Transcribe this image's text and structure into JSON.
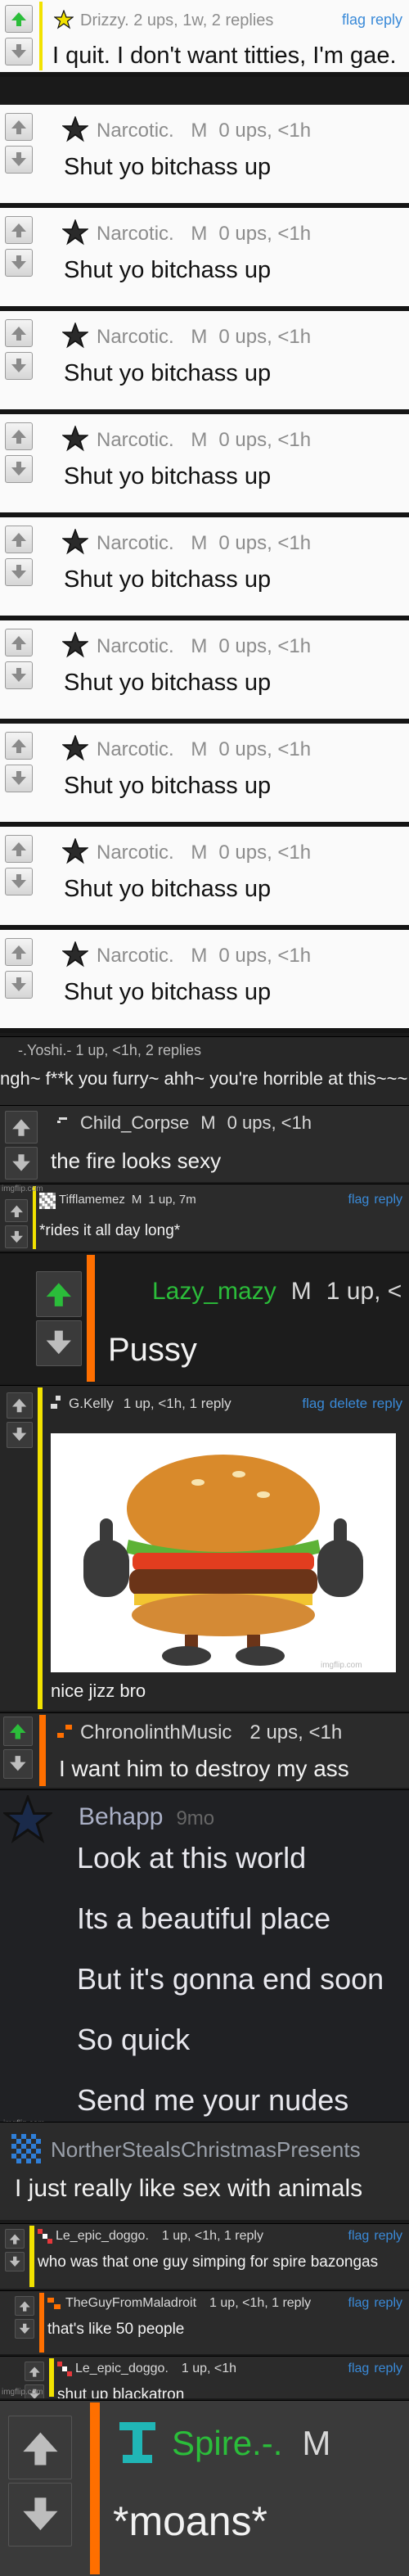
{
  "comments": [
    {
      "user": "Drizzy.",
      "stats": "2 ups, 1w, 2 replies",
      "links": [
        "flag",
        "reply"
      ],
      "text": "I quit. I don't want titties, I'm gae.",
      "upvoted": true
    },
    {
      "user": "Narcotic.",
      "badge": "M",
      "stats": "0 ups, <1h",
      "text": "Shut yo bitchass up"
    },
    {
      "user": "Narcotic.",
      "badge": "M",
      "stats": "0 ups, <1h",
      "text": "Shut yo bitchass up"
    },
    {
      "user": "Narcotic.",
      "badge": "M",
      "stats": "0 ups, <1h",
      "text": "Shut yo bitchass up"
    },
    {
      "user": "Narcotic.",
      "badge": "M",
      "stats": "0 ups, <1h",
      "text": "Shut yo bitchass up"
    },
    {
      "user": "Narcotic.",
      "badge": "M",
      "stats": "0 ups, <1h",
      "text": "Shut yo bitchass up"
    },
    {
      "user": "Narcotic.",
      "badge": "M",
      "stats": "0 ups, <1h",
      "text": "Shut yo bitchass up"
    },
    {
      "user": "Narcotic.",
      "badge": "M",
      "stats": "0 ups, <1h",
      "text": "Shut yo bitchass up"
    },
    {
      "user": "Narcotic.",
      "badge": "M",
      "stats": "0 ups, <1h",
      "text": "Shut yo bitchass up"
    },
    {
      "user": "Narcotic.",
      "badge": "M",
      "stats": "0 ups, <1h",
      "text": "Shut yo bitchass up"
    }
  ],
  "yoshi": {
    "header": "-.Yoshi.-   1 up, <1h, 2 replies",
    "text": "ngh~ f**k you furry~ ahh~ you're horrible at this~~~"
  },
  "child": {
    "user": "Child_Corpse",
    "badge": "M",
    "stats": "0 ups, <1h",
    "text": "the fire looks sexy"
  },
  "tiff": {
    "user": "Tifflamemez",
    "badge": "M",
    "stats": "1 up, 7m",
    "links": [
      "flag",
      "reply"
    ],
    "text": "*rides it all day long*"
  },
  "lazy": {
    "user": "Lazy_mazy",
    "badge": "M",
    "stats": "1 up, <",
    "text": "Pussy"
  },
  "gkelly": {
    "user": "G.Kelly",
    "stats": "1 up, <1h, 1 reply",
    "links": [
      "flag",
      "delete",
      "reply"
    ],
    "text": "nice jizz bro"
  },
  "chrono": {
    "user": "ChronolinthMusic",
    "stats": "2 ups, <1h",
    "text": "I want him to destroy my ass"
  },
  "behapp": {
    "user": "Behapp",
    "time": "9mo",
    "lines": [
      "Look at this world",
      "Its a beautiful place",
      "But it's gonna end soon",
      "So quick",
      "Send me your nudes"
    ]
  },
  "norther": {
    "user": "NortherStealsChristmasPresents",
    "text": "I just really like sex with animals"
  },
  "doggo1": {
    "user": "Le_epic_doggo.",
    "stats": "1 up, <1h, 1 reply",
    "links": [
      "flag",
      "reply"
    ],
    "text": "who was that one guy simping for spire bazongas"
  },
  "guy": {
    "user": "TheGuyFromMaladroit",
    "stats": "1 up, <1h, 1 reply",
    "links": [
      "flag",
      "reply"
    ],
    "text": "that's like 50 people"
  },
  "doggo2": {
    "user": "Le_epic_doggo.",
    "stats": "1 up, <1h",
    "links": [
      "flag",
      "reply"
    ],
    "text": "shut up blackatron"
  },
  "spire": {
    "user": "Spire.-.",
    "badge": "M",
    "text": "*moans*"
  },
  "watermark": "imgflip.com",
  "colors": {
    "yellow": "#f2e200",
    "orange": "#ff6f00",
    "green": "#2bbd3a",
    "teal": "#20b6b6",
    "link": "#3a8ad8"
  }
}
